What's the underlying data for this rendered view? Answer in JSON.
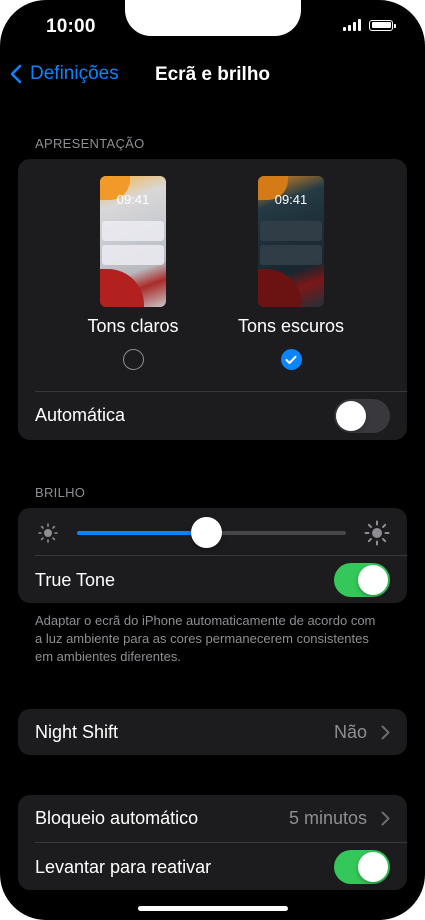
{
  "status_bar": {
    "time": "10:00"
  },
  "nav": {
    "back_label": "Definições",
    "title": "Ecrã e brilho"
  },
  "appearance": {
    "header": "APRESENTAÇÃO",
    "light": {
      "label": "Tons claros",
      "clock": "09:41",
      "selected": false
    },
    "dark": {
      "label": "Tons escuros",
      "clock": "09:41",
      "selected": true
    },
    "automatic": {
      "label": "Automática",
      "on": false
    }
  },
  "brightness": {
    "header": "BRILHO",
    "level_fraction": 0.48,
    "true_tone": {
      "label": "True Tone",
      "on": true
    },
    "footnote": "Adaptar o ecrã do iPhone automaticamente de acordo com a luz ambiente para as cores permanecerem consistentes em ambientes diferentes."
  },
  "night_shift": {
    "label": "Night Shift",
    "value": "Não"
  },
  "lock": {
    "auto_lock": {
      "label": "Bloqueio automático",
      "value": "5 minutos"
    },
    "raise_to_wake": {
      "label": "Levantar para reativar",
      "on": true
    }
  },
  "colors": {
    "accent": "#0a84ff",
    "toggle_on": "#34c759",
    "cell_bg": "#1c1c1e",
    "secondary_text": "#8e8e93"
  }
}
